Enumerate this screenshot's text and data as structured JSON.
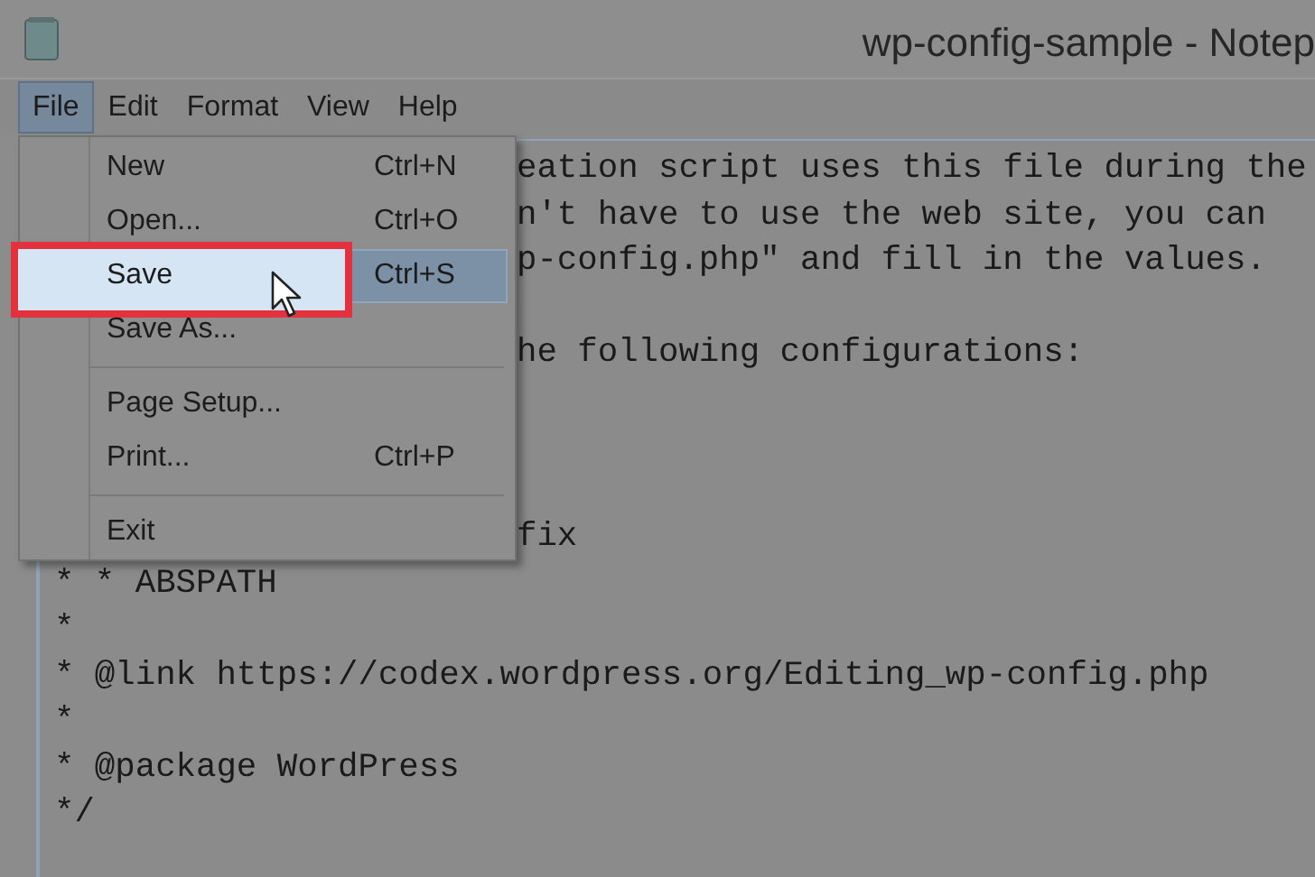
{
  "window": {
    "title": "wp-config-sample - Notep"
  },
  "menu_bar": [
    {
      "label": "File",
      "selected": true
    },
    {
      "label": "Edit",
      "selected": false
    },
    {
      "label": "Format",
      "selected": false
    },
    {
      "label": "View",
      "selected": false
    },
    {
      "label": "Help",
      "selected": false
    }
  ],
  "file_menu": {
    "items": [
      {
        "kind": "item",
        "label": "New",
        "shortcut": "Ctrl+N",
        "selected": false
      },
      {
        "kind": "item",
        "label": "Open...",
        "shortcut": "Ctrl+O",
        "selected": false
      },
      {
        "kind": "item",
        "label": "Save",
        "shortcut": "Ctrl+S",
        "selected": true
      },
      {
        "kind": "item",
        "label": "Save As...",
        "selected": false
      },
      {
        "kind": "separator"
      },
      {
        "kind": "item",
        "label": "Page Setup...",
        "selected": false
      },
      {
        "kind": "item",
        "label": "Print...",
        "shortcut": "Ctrl+P",
        "selected": false
      },
      {
        "kind": "separator"
      },
      {
        "kind": "item",
        "label": "Exit",
        "selected": false
      }
    ]
  },
  "editor": {
    "lines": [
      {
        "kind": "partial",
        "text": "eation script uses this file during the"
      },
      {
        "kind": "partial",
        "text": "n't have to use the web site, you can"
      },
      {
        "kind": "partial",
        "text": "p-config.php\" and fill in the values."
      },
      {
        "kind": "blank"
      },
      {
        "kind": "partial",
        "text": "he following configurations:"
      },
      {
        "kind": "blank"
      },
      {
        "kind": "blank"
      },
      {
        "kind": "blank"
      },
      {
        "kind": "partial",
        "text": "fix"
      },
      {
        "kind": "full",
        "text": "* * ABSPATH"
      },
      {
        "kind": "full",
        "text": "*"
      },
      {
        "kind": "full",
        "text": "* @link https://codex.wordpress.org/Editing_wp-config.php"
      },
      {
        "kind": "full",
        "text": "*"
      },
      {
        "kind": "full",
        "text": "* @package WordPress"
      },
      {
        "kind": "full",
        "text": "*/"
      }
    ]
  }
}
